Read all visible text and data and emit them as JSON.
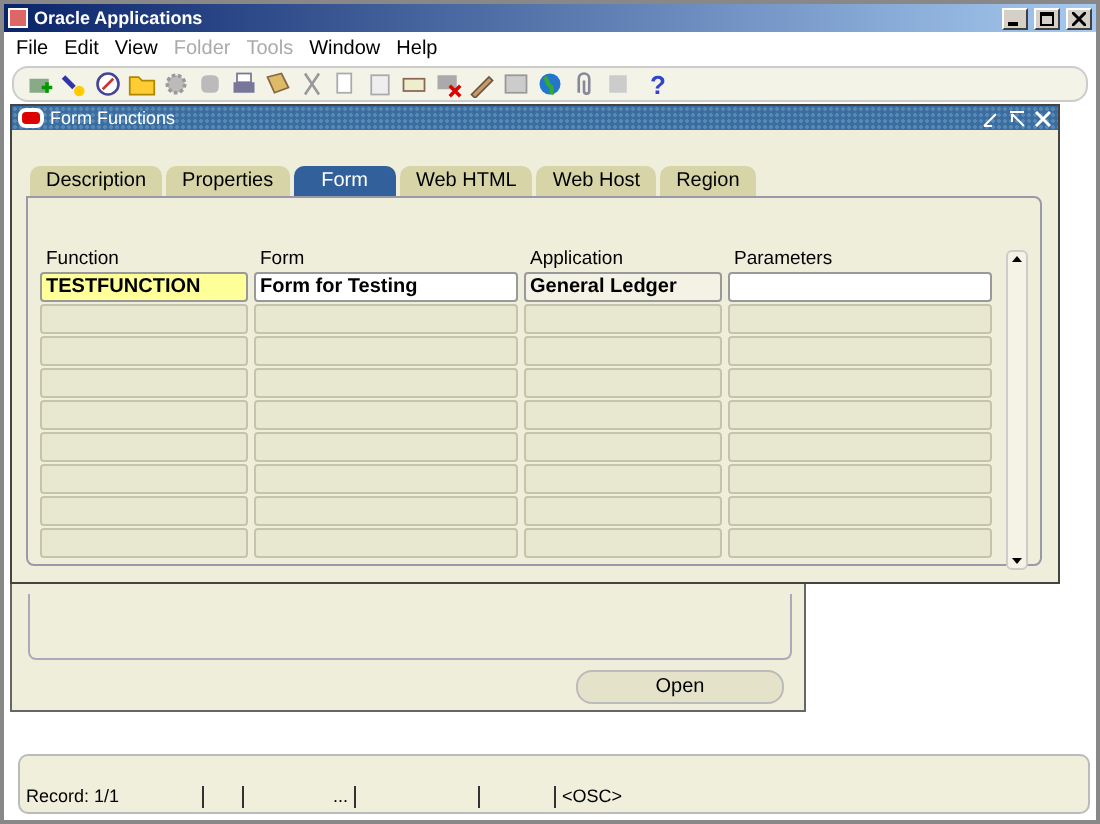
{
  "window": {
    "title": "Oracle Applications"
  },
  "menu": [
    {
      "label": "File",
      "disabled": false
    },
    {
      "label": "Edit",
      "disabled": false
    },
    {
      "label": "View",
      "disabled": false
    },
    {
      "label": "Folder",
      "disabled": true
    },
    {
      "label": "Tools",
      "disabled": true
    },
    {
      "label": "Window",
      "disabled": false
    },
    {
      "label": "Help",
      "disabled": false
    }
  ],
  "form_window": {
    "title": "Form Functions",
    "tabs": [
      {
        "label": "Description",
        "selected": false
      },
      {
        "label": "Properties",
        "selected": false
      },
      {
        "label": "Form",
        "selected": true
      },
      {
        "label": "Web HTML",
        "selected": false
      },
      {
        "label": "Web Host",
        "selected": false
      },
      {
        "label": "Region",
        "selected": false
      }
    ],
    "columns": [
      {
        "label": "Function",
        "focused": true
      },
      {
        "label": "Form",
        "focused": false
      },
      {
        "label": "Application",
        "focused": false
      },
      {
        "label": "Parameters",
        "focused": false
      }
    ],
    "rows": [
      {
        "current": true,
        "cells": [
          "TESTFUNCTION",
          "Form for Testing",
          "General Ledger"
        ]
      },
      {
        "current": false,
        "cells": []
      },
      {
        "current": false,
        "cells": []
      },
      {
        "current": false,
        "cells": []
      },
      {
        "current": false,
        "cells": []
      },
      {
        "current": false,
        "cells": []
      },
      {
        "current": false,
        "cells": []
      },
      {
        "current": false,
        "cells": []
      },
      {
        "current": false,
        "cells": []
      }
    ]
  },
  "toolbar": {
    "help": "?"
  },
  "navigator": {
    "button": "Open"
  },
  "status_bar": {
    "record": "Record: 1/1",
    "segment_3": "...",
    "mode": "<OSC>"
  }
}
